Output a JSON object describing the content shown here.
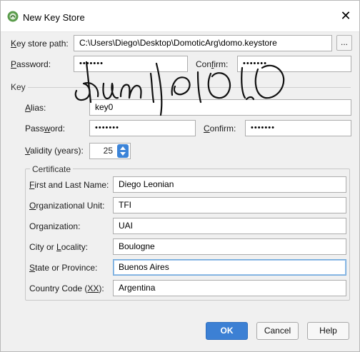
{
  "window": {
    "title": "New Key Store",
    "close_glyph": "✕"
  },
  "keystore": {
    "path_label_pre": "",
    "path_label_ul": "K",
    "path_label_post": "ey store path:",
    "path_value": "C:\\Users\\Diego\\Desktop\\DomoticArg\\domo.keystore",
    "browse_label": "...",
    "password_label_ul": "P",
    "password_label_post": "assword:",
    "password_value": "•••••••",
    "confirm_label_pre": "Con",
    "confirm_label_ul": "f",
    "confirm_label_post": "irm:",
    "confirm_value": "•••••••"
  },
  "key": {
    "section_title": "Key",
    "alias_label_ul": "A",
    "alias_label_post": "lias:",
    "alias_value": "key0",
    "password_label_pre": "Pass",
    "password_label_ul": "w",
    "password_label_post": "ord:",
    "password_value": "•••••••",
    "confirm_label_ul": "C",
    "confirm_label_post": "onfirm:",
    "confirm_value": "•••••••",
    "validity_label_ul": "V",
    "validity_label_post": "alidity (years):",
    "validity_value": "25"
  },
  "certificate": {
    "title": "Certificate",
    "first_last_label_ul": "F",
    "first_last_label_post": "irst and Last Name:",
    "first_last_value": "Diego Leonian",
    "org_unit_label_ul": "O",
    "org_unit_label_post": "rganizational Unit:",
    "org_unit_value": "TFI",
    "org_label_pre": "Or",
    "org_label_ul": "g",
    "org_label_post": "anization:",
    "org_value": "UAI",
    "city_label_pre": "City or ",
    "city_label_ul": "L",
    "city_label_post": "ocality:",
    "city_value": "Boulogne",
    "state_label_ul": "S",
    "state_label_post": "tate or Province:",
    "state_value": "Buenos Aires",
    "country_label_pre": "Country Code (",
    "country_label_ul": "XX",
    "country_label_post": "):",
    "country_value": "Argentina"
  },
  "buttons": {
    "ok": "OK",
    "cancel": "Cancel",
    "help": "Help"
  },
  "colors": {
    "primary_button": "#3c80d4",
    "spinner_arrows": "#3c84d8",
    "focus_border": "#6fa8dc",
    "scribble_ink": "#111111"
  }
}
